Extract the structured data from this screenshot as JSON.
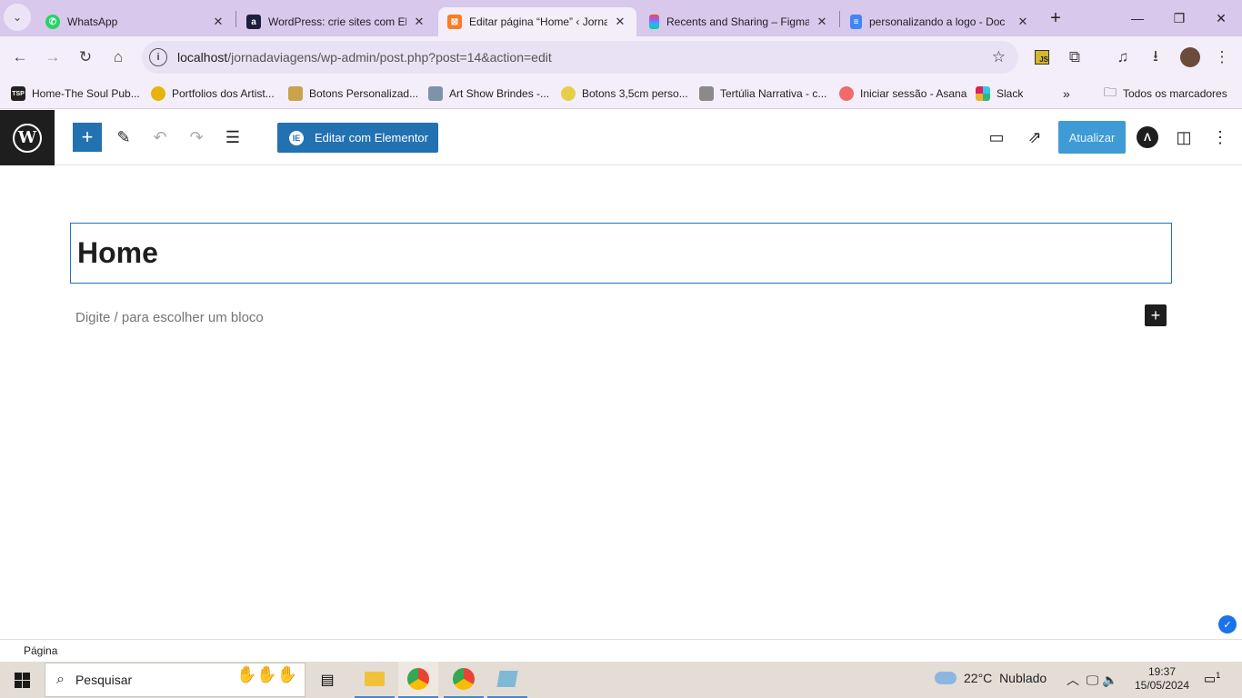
{
  "browser": {
    "tabs": [
      {
        "title": "WhatsApp",
        "icon": "whatsapp-icon",
        "active": false
      },
      {
        "title": "WordPress: crie sites com Ele",
        "icon": "wordpress-icon",
        "active": false
      },
      {
        "title": "Editar página “Home” ‹ Jorna",
        "icon": "xampp-icon",
        "active": true
      },
      {
        "title": "Recents and Sharing – Figma",
        "icon": "figma-icon",
        "active": false
      },
      {
        "title": "personalizando a logo - Doc",
        "icon": "docs-icon",
        "active": false
      }
    ],
    "url_host": "localhost",
    "url_path": "/jornadaviagens/wp-admin/post.php?post=14&action=edit",
    "bookmarks": [
      {
        "label": "Home-The Soul Pub...",
        "icon_text": "TSP"
      },
      {
        "label": "Portfolios dos Artist...",
        "icon_text": ""
      },
      {
        "label": "Botons Personalizad...",
        "icon_text": ""
      },
      {
        "label": "Art Show Brindes -...",
        "icon_text": ""
      },
      {
        "label": "Botons 3,5cm perso...",
        "icon_text": ""
      },
      {
        "label": "Tertúlia Narrativa - c...",
        "icon_text": ""
      },
      {
        "label": "Iniciar sessão - Asana",
        "icon_text": ""
      },
      {
        "label": "Slack",
        "icon_text": ""
      }
    ],
    "all_bookmarks": "Todos os marcadores"
  },
  "editor": {
    "elementor_label": "Editar com Elementor",
    "update_label": "Atualizar",
    "page_title": "Home",
    "block_placeholder": "Digite / para escolher um bloco",
    "footer_breadcrumb": "Página"
  },
  "taskbar": {
    "search_placeholder": "Pesquisar",
    "temperature": "22°C",
    "weather": "Nublado",
    "time": "19:37",
    "date": "15/05/2024",
    "notification_count": "1"
  },
  "colors": {
    "wp_blue": "#2271b1",
    "tabstrip": "#d8c8ec",
    "chrome_toolbar": "#f4eefb"
  }
}
